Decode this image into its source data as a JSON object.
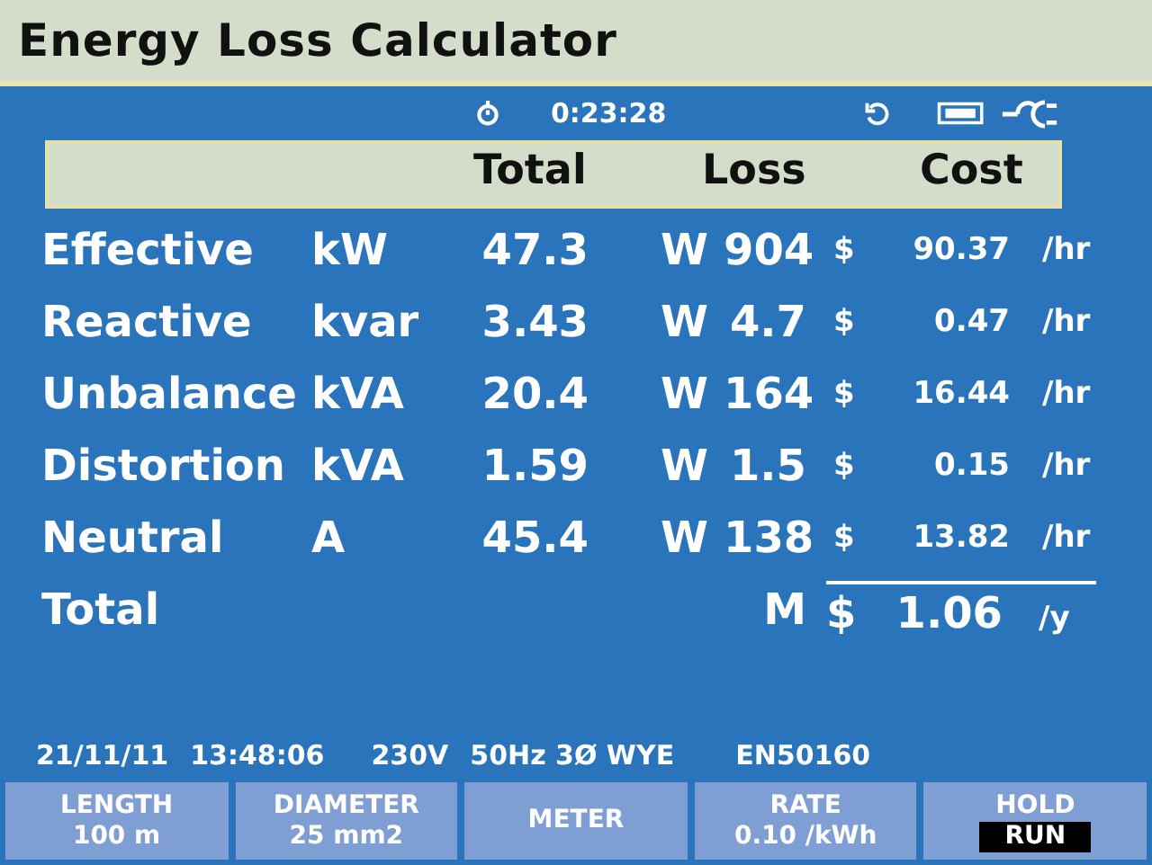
{
  "window": {
    "title": "Energy Loss Calculator"
  },
  "status": {
    "timer": "0:23:28"
  },
  "columns": [
    "Total",
    "Loss",
    "Cost"
  ],
  "rows": [
    {
      "name": "Effective",
      "unit": "kW",
      "total": "47.3",
      "loss_unit": "W",
      "loss": "904",
      "currency": "$",
      "cost": "90.37",
      "cost_unit": "/hr"
    },
    {
      "name": "Reactive",
      "unit": "kvar",
      "total": "3.43",
      "loss_unit": "W",
      "loss": "4.7",
      "currency": "$",
      "cost": "0.47",
      "cost_unit": "/hr"
    },
    {
      "name": "Unbalance",
      "unit": "kVA",
      "total": "20.4",
      "loss_unit": "W",
      "loss": "164",
      "currency": "$",
      "cost": "16.44",
      "cost_unit": "/hr"
    },
    {
      "name": "Distortion",
      "unit": "kVA",
      "total": "1.59",
      "loss_unit": "W",
      "loss": "1.5",
      "currency": "$",
      "cost": "0.15",
      "cost_unit": "/hr"
    },
    {
      "name": "Neutral",
      "unit": "A",
      "total": "45.4",
      "loss_unit": "W",
      "loss": "138",
      "currency": "$",
      "cost": "13.82",
      "cost_unit": "/hr"
    }
  ],
  "total": {
    "label": "Total",
    "prefix": "M",
    "currency": "$",
    "cost": "1.06",
    "cost_unit": "/y"
  },
  "status_bar": [
    "21/11/11",
    "13:48:06",
    "230V",
    "50Hz 3Ø WYE",
    "EN50160"
  ],
  "softkeys": [
    {
      "kind": "value",
      "label": "LENGTH",
      "value": "100 m"
    },
    {
      "kind": "value",
      "label": "DIAMETER",
      "value": "25 mm2"
    },
    {
      "kind": "plain",
      "label": "METER"
    },
    {
      "kind": "value",
      "label": "RATE",
      "value": "0.10 /kWh"
    },
    {
      "kind": "toggle",
      "options": [
        {
          "label": "HOLD",
          "selected": false
        },
        {
          "label": "RUN",
          "selected": true
        }
      ]
    }
  ]
}
